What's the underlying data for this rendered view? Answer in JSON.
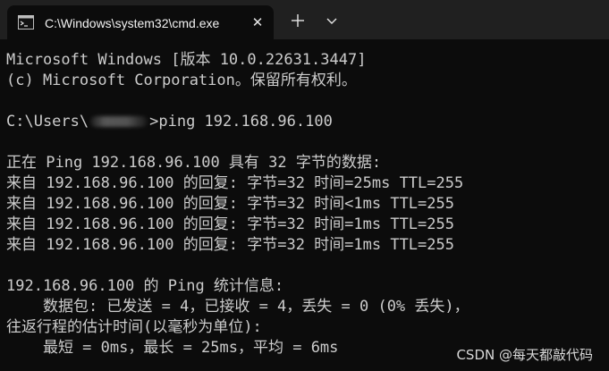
{
  "tab": {
    "title": "C:\\Windows\\system32\\cmd.exe",
    "icon": "cmd-icon"
  },
  "titlebar": {
    "close_glyph": "✕",
    "new_tab_icon": "plus-icon",
    "dropdown_icon": "chevron-down-icon"
  },
  "terminal": {
    "banner": [
      "Microsoft Windows [版本 10.0.22631.3447]",
      "(c) Microsoft Corporation。保留所有权利。"
    ],
    "prompt_prefix": "C:\\Users\\",
    "prompt_suffix": ">ping 192.168.96.100",
    "ping_header": "正在 Ping 192.168.96.100 具有 32 字节的数据:",
    "replies": [
      "来自 192.168.96.100 的回复: 字节=32 时间=25ms TTL=255",
      "来自 192.168.96.100 的回复: 字节=32 时间<1ms TTL=255",
      "来自 192.168.96.100 的回复: 字节=32 时间=1ms TTL=255",
      "来自 192.168.96.100 的回复: 字节=32 时间=1ms TTL=255"
    ],
    "stats": [
      "192.168.96.100 的 Ping 统计信息:",
      "    数据包: 已发送 = 4，已接收 = 4，丢失 = 0 (0% 丢失)，",
      "往返行程的估计时间(以毫秒为单位):",
      "    最短 = 0ms，最长 = 25ms，平均 = 6ms"
    ]
  },
  "watermark": "CSDN @每天都敲代码",
  "colors": {
    "background": "#0c0c0c",
    "titlebar": "#202020",
    "text": "#cccccc"
  }
}
